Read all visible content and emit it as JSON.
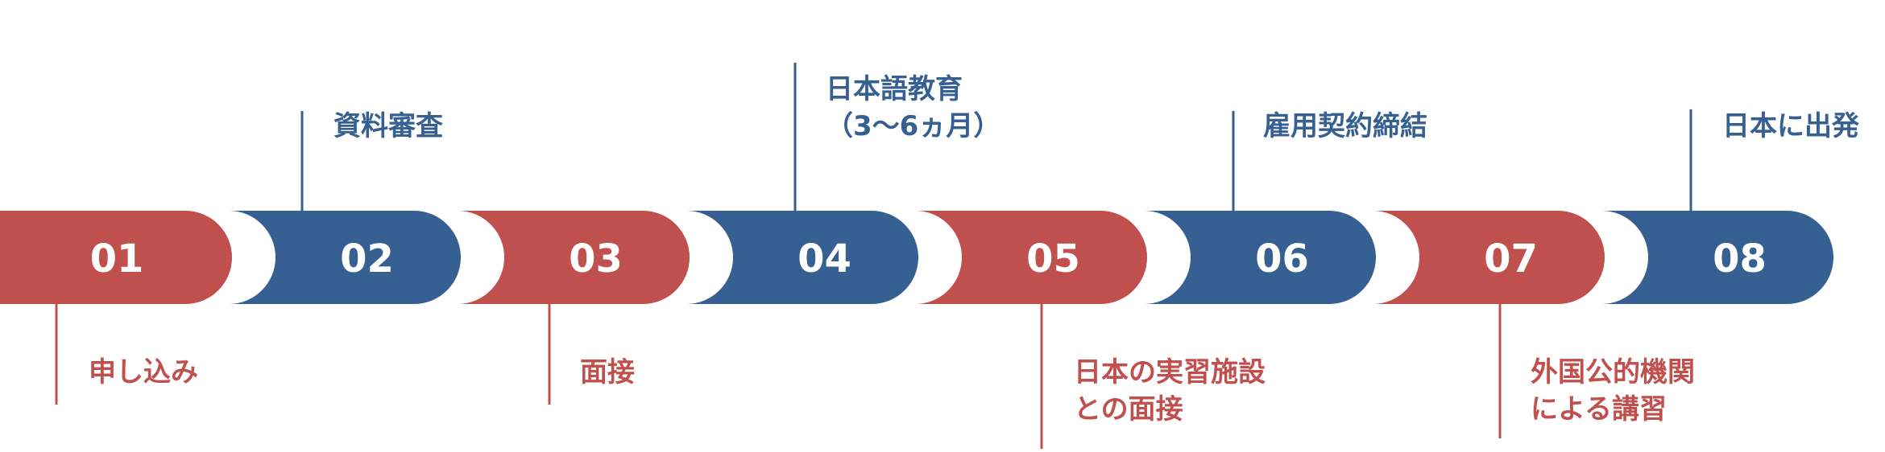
{
  "colors": {
    "red": "#C0504D",
    "blue": "#376092",
    "background": "#FFFFFF"
  },
  "steps": [
    {
      "number": "01",
      "color": "red",
      "label_lines": [
        "申し込み"
      ]
    },
    {
      "number": "02",
      "color": "blue",
      "label_lines": [
        "資料審査"
      ]
    },
    {
      "number": "03",
      "color": "red",
      "label_lines": [
        "面接"
      ]
    },
    {
      "number": "04",
      "color": "blue",
      "label_lines": [
        "日本語教育",
        "（3～6ヵ月）"
      ]
    },
    {
      "number": "05",
      "color": "red",
      "label_lines": [
        "日本の実習施設",
        "との面接"
      ]
    },
    {
      "number": "06",
      "color": "blue",
      "label_lines": [
        "雇用契約締結"
      ]
    },
    {
      "number": "07",
      "color": "red",
      "label_lines": [
        "外国公的機関",
        "による講習"
      ]
    },
    {
      "number": "08",
      "color": "blue",
      "label_lines": [
        "日本に出発"
      ]
    }
  ]
}
